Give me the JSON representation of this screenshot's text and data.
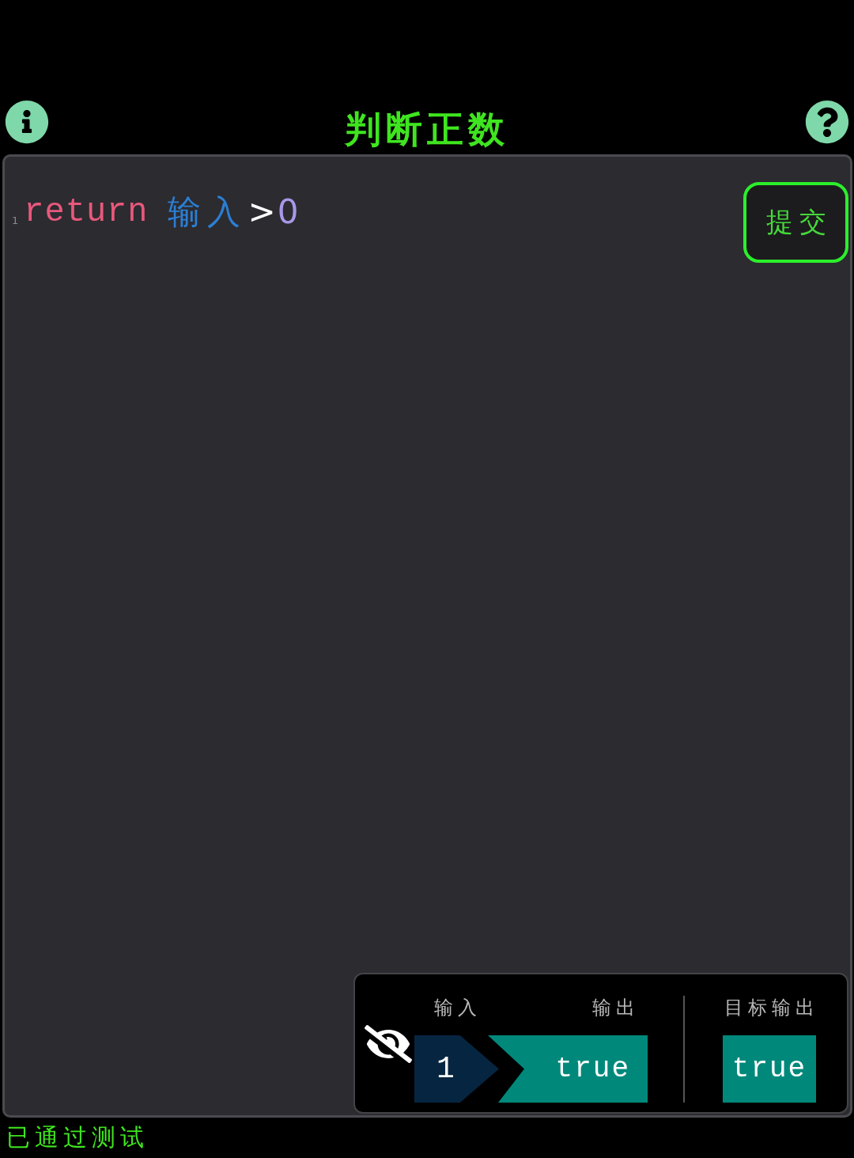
{
  "header": {
    "title": "判断正数"
  },
  "editor": {
    "lines": [
      {
        "number": "1",
        "tokens": [
          {
            "kind": "keyword",
            "text": "return"
          },
          {
            "kind": "variable",
            "text": "输入"
          },
          {
            "kind": "operator",
            "text": ">"
          },
          {
            "kind": "number",
            "text": "0"
          }
        ]
      }
    ],
    "submit_button": "提交"
  },
  "test_panel": {
    "labels": {
      "input": "输入",
      "output": "输出",
      "target": "目标输出"
    },
    "cases": [
      {
        "input": "1",
        "output": "true",
        "target": "true",
        "passed": true
      }
    ]
  },
  "status_bar": {
    "text": "已通过测试"
  }
}
